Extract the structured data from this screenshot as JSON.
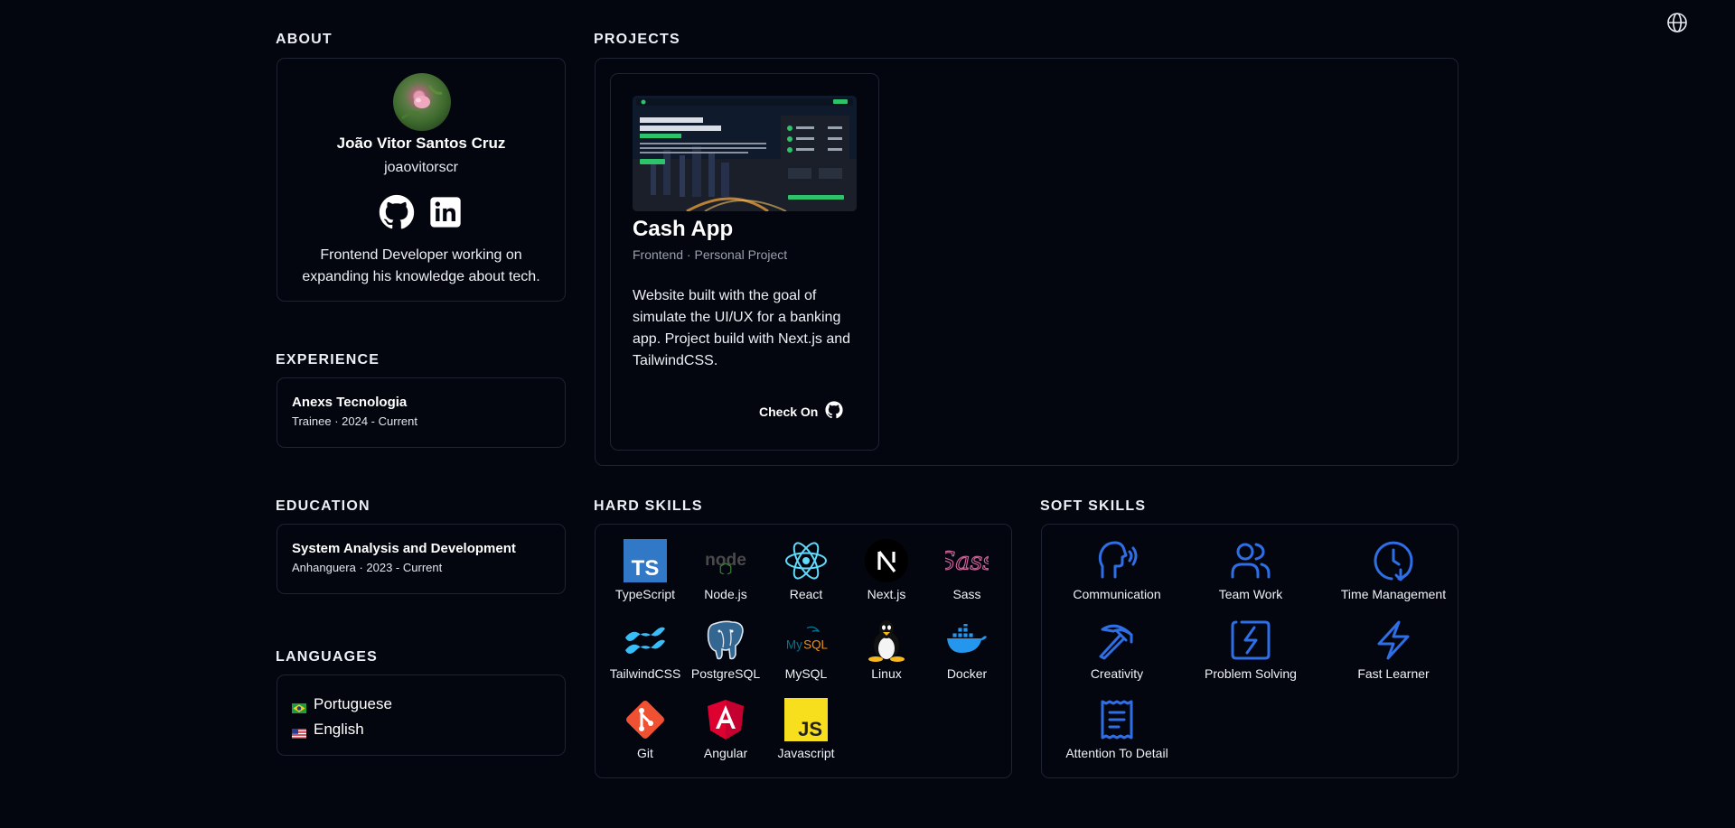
{
  "header": {
    "globe_icon": "globe-icon"
  },
  "sections": {
    "about": "ABOUT",
    "projects": "PROJECTS",
    "experience": "EXPERIENCE",
    "education": "EDUCATION",
    "languages": "LANGUAGES",
    "hard_skills": "HARD SKILLS",
    "soft_skills": "SOFT SKILLS"
  },
  "about": {
    "name": "João Vitor Santos Cruz",
    "username": "joaovitorscr",
    "bio": "Frontend Developer working on expanding his knowledge about tech.",
    "social": [
      "github-icon",
      "linkedin-icon"
    ]
  },
  "experience": [
    {
      "company": "Anexs Tecnologia",
      "detail": "Trainee · 2024 - Current"
    }
  ],
  "education": [
    {
      "course": "System Analysis and Development",
      "detail": "Anhanguera · 2023 - Current"
    }
  ],
  "languages": [
    {
      "name": "Portuguese",
      "flag": "brazil-flag-icon"
    },
    {
      "name": "English",
      "flag": "us-flag-icon"
    }
  ],
  "projects": [
    {
      "name": "Cash App",
      "meta": "Frontend · Personal Project",
      "description": "Website built with the goal of simulate the UI/UX for a banking app. Project build with Next.js and TailwindCSS.",
      "link_label": "Check On",
      "thumb_heading": "Welcome to Cash App Empowering Your Financial Journey"
    }
  ],
  "hard_skills": [
    "TypeScript",
    "Node.js",
    "React",
    "Next.js",
    "Sass",
    "TailwindCSS",
    "PostgreSQL",
    "MySQL",
    "Linux",
    "Docker",
    "Git",
    "Angular",
    "Javascript"
  ],
  "soft_skills": [
    "Communication",
    "Team Work",
    "Time Management",
    "Creativity",
    "Problem Solving",
    "Fast Learner",
    "Attention To Detail"
  ],
  "colors": {
    "background": "#03050f",
    "border": "#1f2433",
    "accent_blue": "#2f6fe6"
  }
}
